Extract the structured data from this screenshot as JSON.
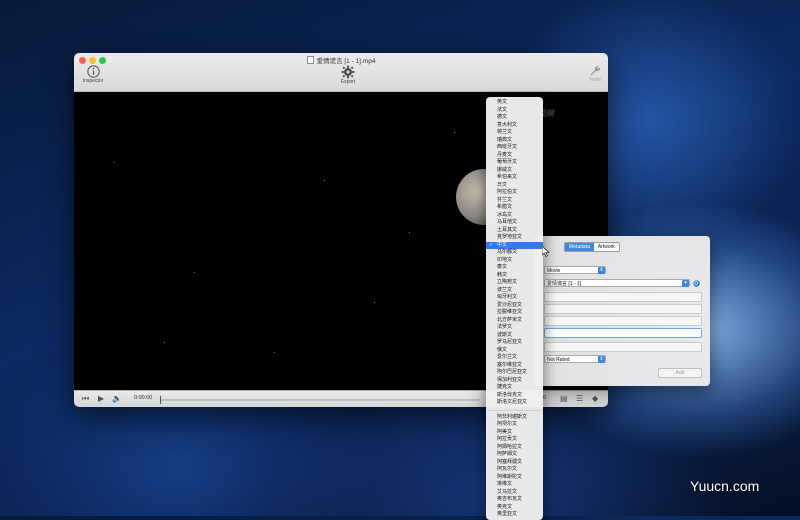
{
  "window": {
    "title": "爱情谎言 [1 - 1].mp4",
    "toolbar": {
      "inspector_label": "Inspector",
      "export_label": "Export",
      "tools_label": "Tools"
    }
  },
  "player": {
    "current_time": "0:00:00",
    "end_time": "00",
    "progress": 0,
    "watermark": "腾讯视频"
  },
  "inspector": {
    "tabs": [
      "Metadata",
      "Artwork"
    ],
    "active_tab": "Metadata",
    "media_kind": "Movie",
    "name_value": "爱情谎言 [1 - 1]",
    "rating": "Not Rated",
    "add_button": "Add"
  },
  "language_menu": {
    "selected": "中文",
    "groups": [
      [
        "英文",
        "法文",
        "德文",
        "意大利文",
        "荷兰文",
        "瑞典文",
        "西班牙文",
        "丹麦文",
        "葡萄牙文",
        "挪威文",
        "希伯来文",
        "日文",
        "阿拉伯文",
        "芬兰文",
        "希腊文",
        "冰岛文",
        "马耳他文",
        "土耳其文",
        "克罗地亚文",
        "中文",
        "乌尔都文",
        "印地文",
        "泰文",
        "韩文",
        "立陶宛文",
        "波兰文",
        "匈牙利文",
        "爱沙尼亚文",
        "拉脱维亚文",
        "北方萨米文",
        "法罗文",
        "波斯文",
        "罗马尼亚文",
        "俄文",
        "爱尔兰文",
        "塞尔维亚文",
        "阿尔巴尼亚文",
        "保加利亚文",
        "捷克文",
        "斯洛伐克文",
        "斯洛文尼亚文"
      ],
      [
        "阿非利堪斯文",
        "阿坝尔文",
        "阿美文",
        "阿拉贡文",
        "阿姆哈拉文",
        "阿萨姆文",
        "阿塞拜疆文",
        "阿瓦尔文",
        "阿维斯陀文",
        "埃维文",
        "艾马拉文",
        "奥吉布瓦文",
        "奥克文",
        "奥里亚文"
      ]
    ]
  },
  "site_mark": "Yuucn.com"
}
